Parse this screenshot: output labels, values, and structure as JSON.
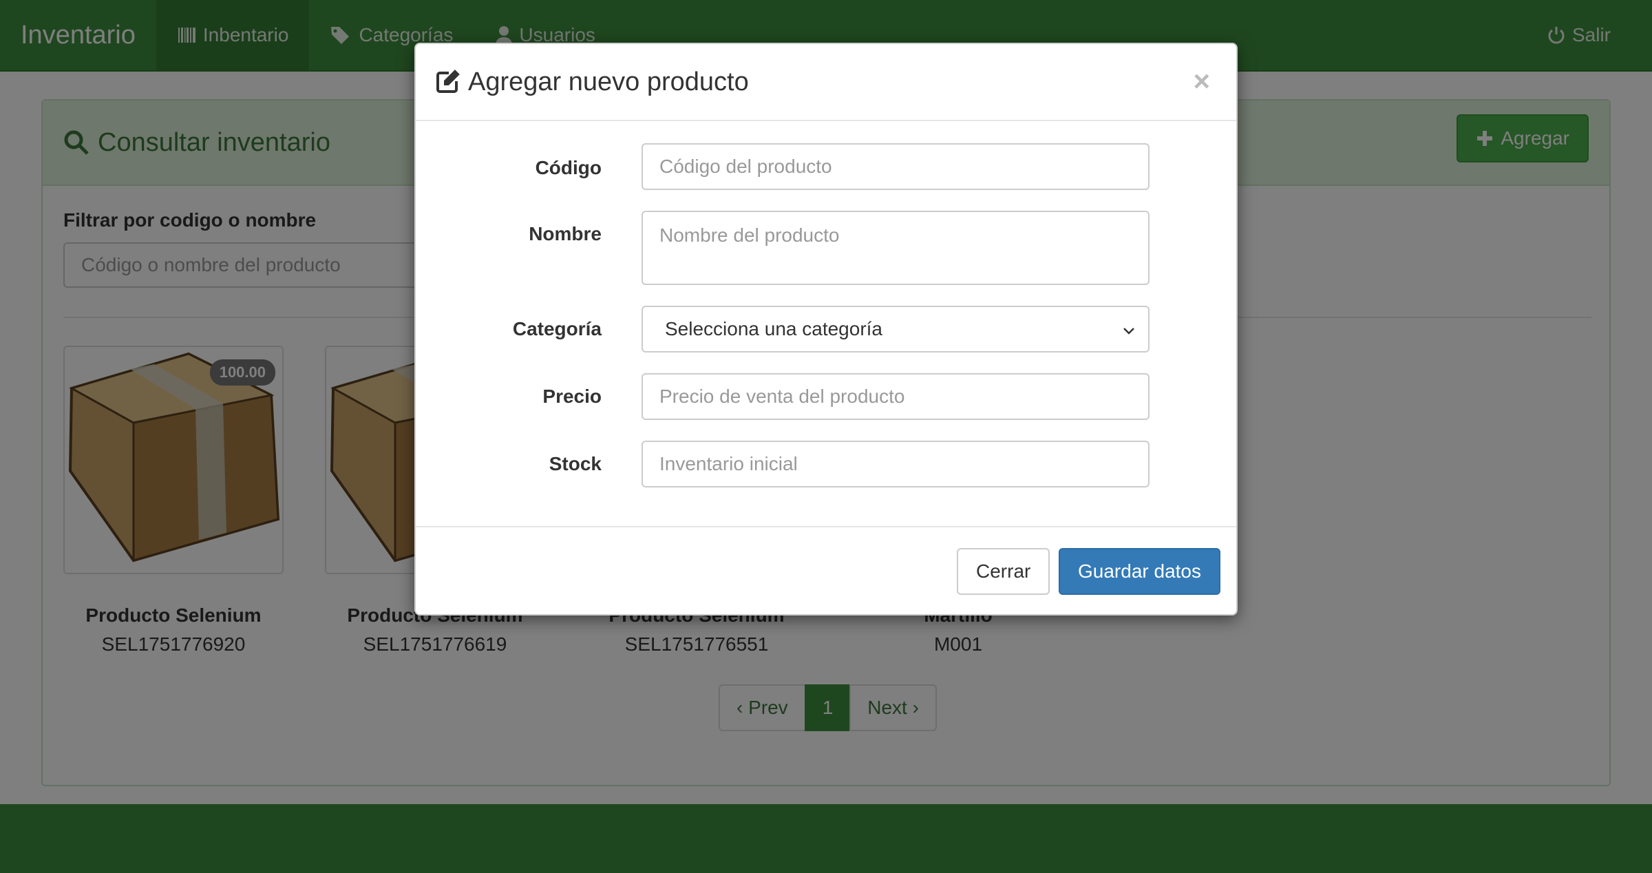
{
  "navbar": {
    "brand": "Inventario",
    "items": [
      {
        "label": "Inbentario",
        "icon": "barcode-icon",
        "active": true
      },
      {
        "label": "Categorías",
        "icon": "tags-icon",
        "active": false
      },
      {
        "label": "Usuarios",
        "icon": "user-icon",
        "active": false
      }
    ],
    "logout_label": "Salir",
    "logout_icon": "power-icon"
  },
  "panel": {
    "title": "Consultar inventario",
    "add_button_label": "Agregar",
    "filter_label": "Filtrar por codigo o nombre",
    "filter_placeholder": "Código o nombre del producto"
  },
  "products": [
    {
      "name": "Producto Selenium",
      "code": "SEL1751776920",
      "price": "100.00"
    },
    {
      "name": "Producto Selenium",
      "code": "SEL1751776619"
    },
    {
      "name": "Producto Selenium",
      "code": "SEL1751776551"
    },
    {
      "name": "Martillo",
      "code": "M001"
    }
  ],
  "pagination": {
    "prev": "‹ Prev",
    "current": "1",
    "next": "Next ›"
  },
  "modal": {
    "title": "Agregar nuevo producto",
    "close_symbol": "×",
    "fields": {
      "codigo": {
        "label": "Código",
        "placeholder": "Código del producto"
      },
      "nombre": {
        "label": "Nombre",
        "placeholder": "Nombre del producto"
      },
      "categoria": {
        "label": "Categoría",
        "selected": "Selecciona una categoría"
      },
      "precio": {
        "label": "Precio",
        "placeholder": "Precio de venta del producto"
      },
      "stock": {
        "label": "Stock",
        "placeholder": "Inventario inicial"
      }
    },
    "close_button_label": "Cerrar",
    "save_button_label": "Guardar datos"
  },
  "colors": {
    "brand_green": "#3e8e3e",
    "primary_blue": "#337ab7"
  }
}
